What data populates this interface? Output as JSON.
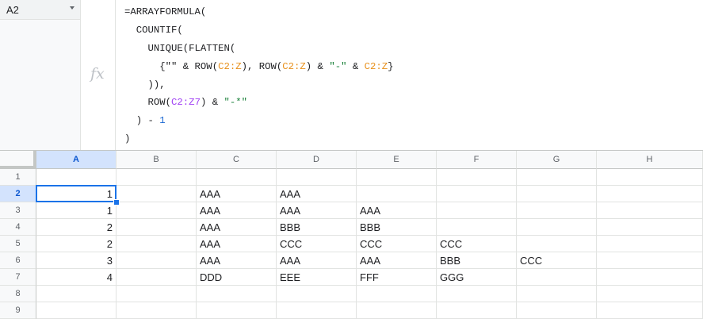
{
  "name_box": {
    "value": "A2"
  },
  "formula_bar": {
    "fx_label": "fx",
    "lines": [
      [
        {
          "t": "=ARRAYFORMULA(",
          "c": ""
        }
      ],
      [
        {
          "t": "  COUNTIF(",
          "c": ""
        }
      ],
      [
        {
          "t": "    UNIQUE(FLATTEN(",
          "c": ""
        }
      ],
      [
        {
          "t": "      {\"\" & ROW(",
          "c": ""
        },
        {
          "t": "C2:Z",
          "c": "ref-c"
        },
        {
          "t": "), ROW(",
          "c": ""
        },
        {
          "t": "C2:Z",
          "c": "ref-c"
        },
        {
          "t": ") & ",
          "c": ""
        },
        {
          "t": "\"-\"",
          "c": "str"
        },
        {
          "t": " & ",
          "c": ""
        },
        {
          "t": "C2:Z",
          "c": "ref-c"
        },
        {
          "t": "}",
          "c": ""
        }
      ],
      [
        {
          "t": "    )),",
          "c": ""
        }
      ],
      [
        {
          "t": "    ROW(",
          "c": ""
        },
        {
          "t": "C2:Z7",
          "c": "ref-m"
        },
        {
          "t": ") & ",
          "c": ""
        },
        {
          "t": "\"-*\"",
          "c": "str"
        }
      ],
      [
        {
          "t": "  ) - ",
          "c": ""
        },
        {
          "t": "1",
          "c": "num"
        }
      ],
      [
        {
          "t": ")",
          "c": ""
        }
      ]
    ]
  },
  "columns": [
    "A",
    "B",
    "C",
    "D",
    "E",
    "F",
    "G",
    "H"
  ],
  "rows": [
    "1",
    "2",
    "3",
    "4",
    "5",
    "6",
    "7",
    "8",
    "9"
  ],
  "active_cell": {
    "col": "A",
    "row": "2"
  },
  "cells": [
    [
      "",
      "",
      "",
      "",
      "",
      "",
      "",
      ""
    ],
    [
      "1",
      "",
      "AAA",
      "AAA",
      "",
      "",
      "",
      ""
    ],
    [
      "1",
      "",
      "AAA",
      "AAA",
      "AAA",
      "",
      "",
      ""
    ],
    [
      "2",
      "",
      "AAA",
      "BBB",
      "BBB",
      "",
      "",
      ""
    ],
    [
      "2",
      "",
      "AAA",
      "CCC",
      "CCC",
      "CCC",
      "",
      ""
    ],
    [
      "3",
      "",
      "AAA",
      "AAA",
      "AAA",
      "BBB",
      "CCC",
      ""
    ],
    [
      "4",
      "",
      "DDD",
      "EEE",
      "FFF",
      "GGG",
      "",
      ""
    ],
    [
      "",
      "",
      "",
      "",
      "",
      "",
      "",
      ""
    ],
    [
      "",
      "",
      "",
      "",
      "",
      "",
      "",
      ""
    ]
  ],
  "colors": {
    "accent": "#1a73e8",
    "header_active": "#d3e3fd"
  }
}
